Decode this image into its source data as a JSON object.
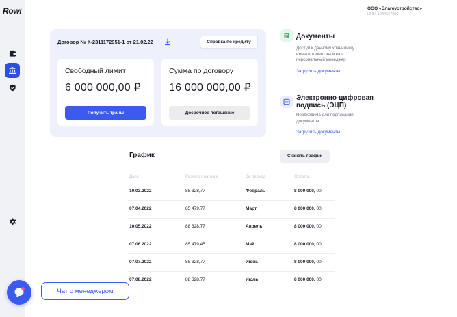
{
  "brand": {
    "logo_text": "Rowi"
  },
  "company": {
    "name": "ООО «Благоустройство»",
    "inn": "ИНН: 1234567890"
  },
  "sidebar": {
    "items": [
      {
        "icon": "wallet-icon",
        "active": false
      },
      {
        "icon": "bank-icon",
        "active": true
      },
      {
        "icon": "shield-check-icon",
        "active": false
      },
      {
        "icon": "gear-icon",
        "active": false
      }
    ]
  },
  "contract": {
    "title": "Договор № К-2311172951-1 от 21.02.22",
    "credit_button": "Справка по кредиту",
    "free_limit": {
      "label": "Свободный лимит",
      "amount": "6 000 000,00 ₽",
      "button": "Получить транш"
    },
    "contract_sum": {
      "label": "Сумма по договору",
      "amount": "16 000 000,00 ₽",
      "button": "Досрочное погашение"
    }
  },
  "documents": {
    "title": "Документы",
    "description": [
      "Доступ к данному хранилищу",
      "имеете только вы и ваш",
      "персональный менеджер"
    ],
    "link": "Загрузить документы"
  },
  "signature": {
    "title_lines": [
      "Электронно-цифровая",
      "подпись (ЭЦП)"
    ],
    "description": [
      "Необходима для подписания",
      "документов"
    ],
    "link": "Загрузить документы"
  },
  "schedule": {
    "title": "График",
    "download_button": "Скачать график",
    "columns": [
      "Дата",
      "Размер платежа",
      "За период",
      "Остаток"
    ],
    "rows": [
      {
        "date": "10.03.2022",
        "amount": "88 328,77",
        "period": "Февраль",
        "rest_main": "8 000 000,",
        "rest_frac": "00"
      },
      {
        "date": "07.04.2022",
        "amount": "85 479,77",
        "period": "Март",
        "rest_main": "8 000 000,",
        "rest_frac": "00"
      },
      {
        "date": "10.05.2022",
        "amount": "88 328,77",
        "period": "Апрель",
        "rest_main": "8 000 000,",
        "rest_frac": "00"
      },
      {
        "date": "07.06.2022",
        "amount": "85 479,45",
        "period": "Май",
        "rest_main": "8 000 000,",
        "rest_frac": "00"
      },
      {
        "date": "07.07.2022",
        "amount": "88 328,77",
        "period": "Июнь",
        "rest_main": "8 000 000,",
        "rest_frac": "00"
      },
      {
        "date": "07.08.2022",
        "amount": "88 328,77",
        "period": "Июль",
        "rest_main": "8 000 000,",
        "rest_frac": "00"
      }
    ]
  },
  "chat": {
    "label": "Чат с менеджером",
    "icon": "chat-icon"
  },
  "colors": {
    "accent": "#3b5bf0",
    "sidebar_bg": "#f1f2f6",
    "card_bg": "#eef1fb",
    "doc_icon": "#3bb56b"
  }
}
